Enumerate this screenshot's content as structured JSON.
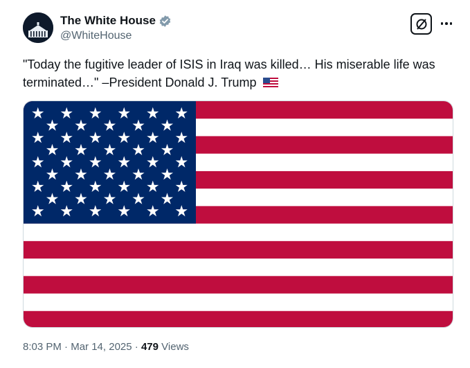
{
  "tweet": {
    "author_name": "The White House",
    "author_handle": "@WhiteHouse",
    "verified_color": "#829aab",
    "text": "\"Today the fugitive leader of ISIS in Iraq was killed… His miserable life was terminated…\" –President Donald J. Trump",
    "emoji": "us-flag",
    "media": {
      "type": "image",
      "subject": "us-flag",
      "colors": {
        "red": "#bf0d3e",
        "white": "#ffffff",
        "blue": "#002868"
      }
    },
    "time": "8:03 PM",
    "separator": "·",
    "date": "Mar 14, 2025",
    "separator2": "·",
    "views_count": "479",
    "views_label": "Views"
  },
  "actions": {
    "grok_icon": "grok-icon",
    "more_icon": "more-icon"
  }
}
